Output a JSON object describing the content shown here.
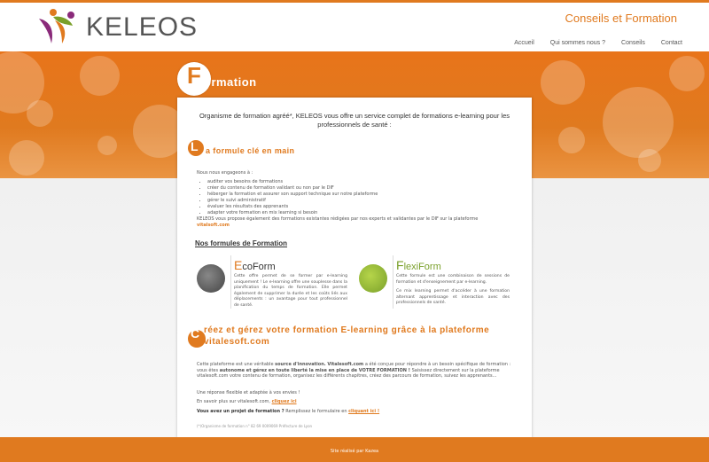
{
  "brand": {
    "name": "KELEOS",
    "tagline": "Conseils et Formation"
  },
  "nav": {
    "items": [
      "Accueil",
      "Qui sommes nous ?",
      "Conseils",
      "Contact"
    ]
  },
  "page": {
    "title_initial": "F",
    "title_rest": "ormation"
  },
  "intro": "Organisme de formation agréé*, KELEOS vous offre un service complet de formations e-learning pour les professionnels de santé :",
  "formule": {
    "initial": "L",
    "title": "a formule clé en main",
    "lead": "Nous nous engageons à :",
    "items": [
      "auditer vos besoins de formations",
      "créer du contenu de formation validant ou non par le DIF",
      "héberger la formation et assurer son support technique sur notre plateforme",
      "gérer le suivi administratif",
      "évaluer les résultats des apprenants",
      "adapter votre formation en mix learning si besoin"
    ],
    "extra": "KELEOS vous propose également des formations existantes rédigées par nos experts et validantes par le DIF sur la plateforme",
    "extra_link": "vitalsoft.com"
  },
  "formules": {
    "title": "Nos formules de Formation"
  },
  "ecoform": {
    "title_initial": "E",
    "title_rest": "coForm",
    "text": "Cette offre permet de se former par e-learning uniquement ! Le e-learning offre une souplesse dans la planification du temps de formation. Elle permet également de supprimer la durée et les coûts liés aux déplacements : un avantage pour tout professionnel de santé."
  },
  "flexiform": {
    "title_initial": "F",
    "title_rest": "lexiForm",
    "text1": "Cette formule est une combinaison de sessions de formation et d'enseignement par e-learning.",
    "text2": "Ce mix learning permet d'accéder à une formation alternant apprentissage et interaction avec des professionnels de santé."
  },
  "platform": {
    "initial": "C",
    "title": "réez et gérez votre formation E-learning grâce à la plateforme vitalesoft.com",
    "p1_a": "Cette plateforme est une véritable",
    "p1_b": "source d'innovation. Vitalesoft.com",
    "p1_c": "a été conçue pour répondre à un besoin spécifique de formation : vous êtes",
    "p1_d": "autonome et gérez en toute liberté la mise en place de VOTRE FORMATION !",
    "p1_e": "Saisissez directement sur la plateforme vitalesoft.com votre contenu de formation, organisez les différents chapitres, créez des parcours de formation, suivez les apprenants...",
    "p2": "Une réponse flexible et adaptée à vos envies !",
    "p3_text": "En savoir plus sur vitalesoft.com,",
    "p3_link": "cliquez ici",
    "p4_strong": "Vous avez un projet de formation ?",
    "p4_text": "Remplissez le formulaire en",
    "p4_link": "cliquant ici !",
    "note": "(*)Organisme de formation n° 82 69 0009069 Préfecture de Lyon"
  },
  "footer": {
    "text": "Site réalisé par Kazea"
  },
  "colors": {
    "accent": "#e07a1f",
    "panel": "#ffffff",
    "text": "#555555"
  }
}
